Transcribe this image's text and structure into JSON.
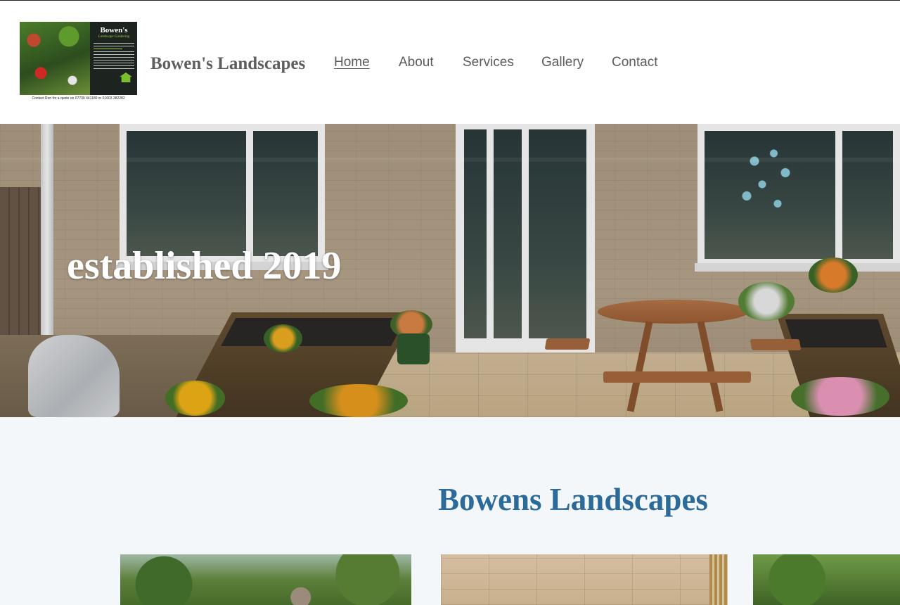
{
  "header": {
    "logo": {
      "title": "Bowen's",
      "subtitle": "Landscape Gardening",
      "contact": "Contact Ron for a quote on 07739 441180 or 01603 382282"
    },
    "brand": "Bowen's Landscapes",
    "nav": [
      {
        "label": "Home",
        "active": true
      },
      {
        "label": "About",
        "active": false
      },
      {
        "label": "Services",
        "active": false
      },
      {
        "label": "Gallery",
        "active": false
      },
      {
        "label": "Contact",
        "active": false
      }
    ]
  },
  "hero": {
    "headline": "established 2019"
  },
  "main": {
    "title": "Bowens Landscapes"
  },
  "colors": {
    "title_blue": "#2b6a99",
    "nav_text": "#5b5b5b",
    "page_bg": "#f3f7f9"
  }
}
